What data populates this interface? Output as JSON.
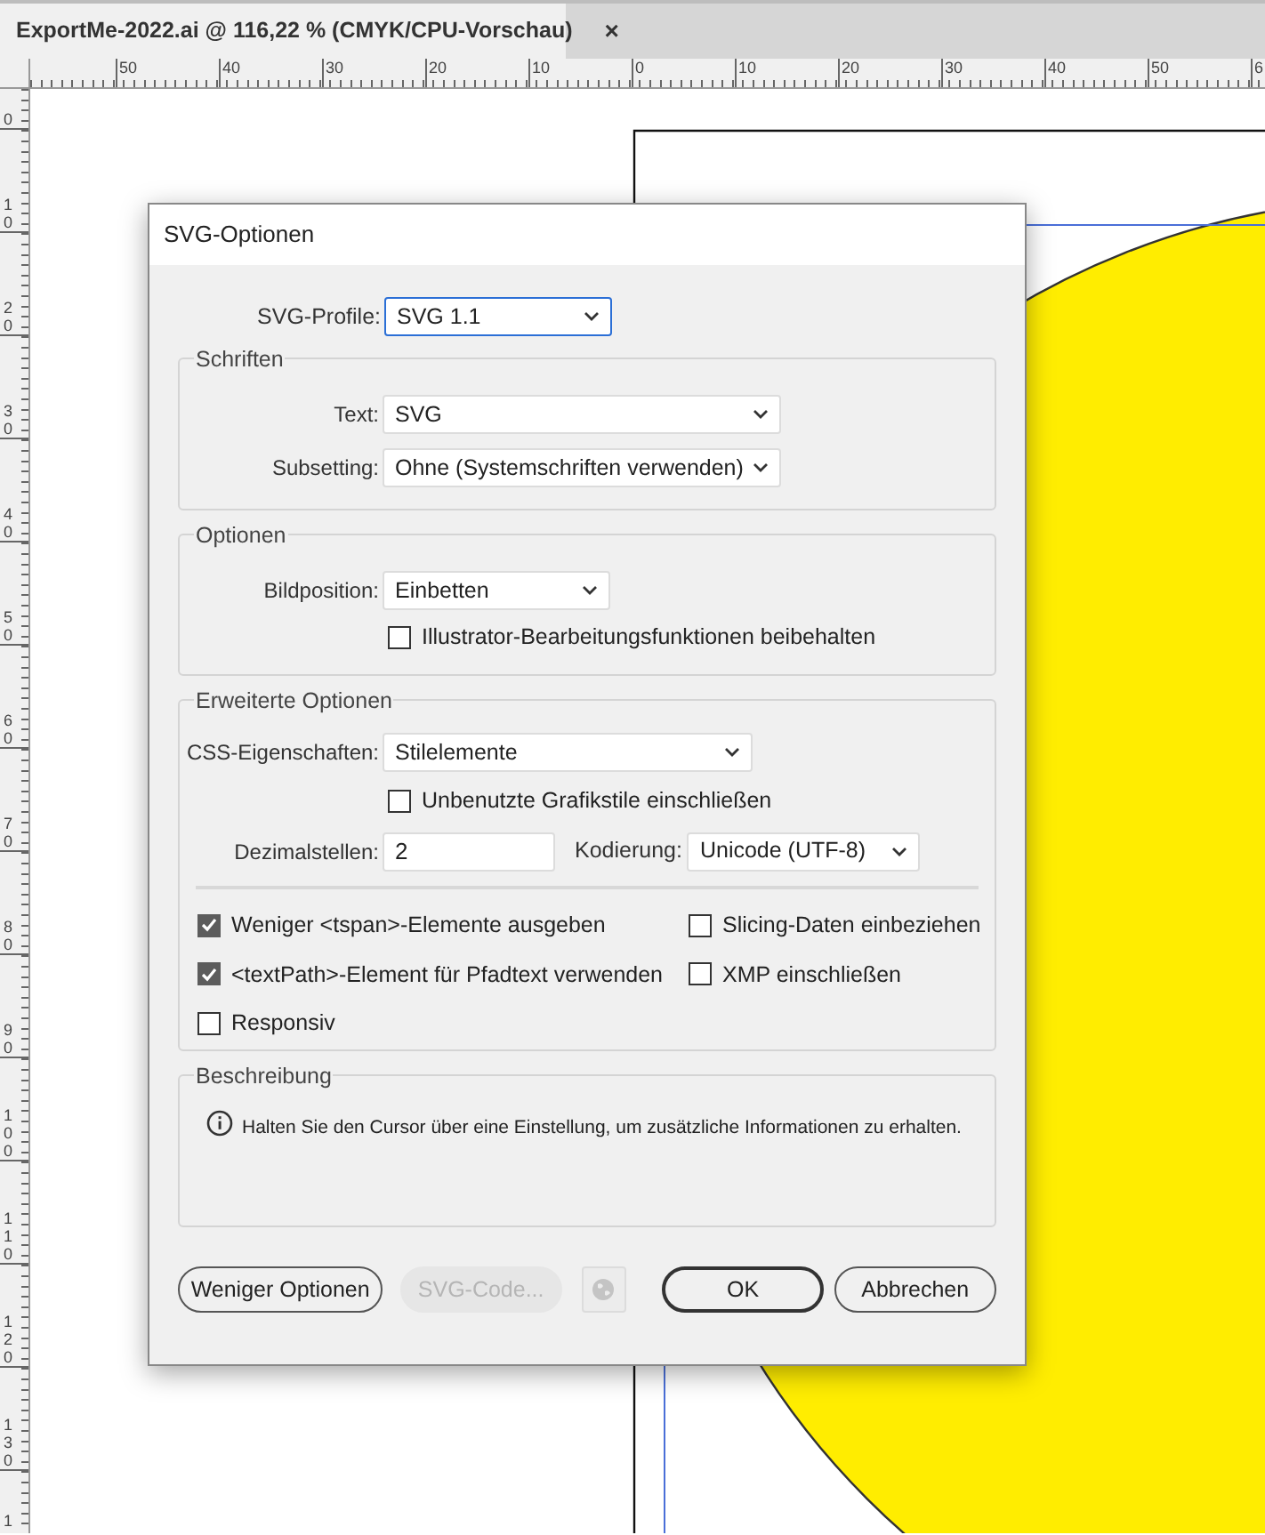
{
  "document_tab": {
    "title": "ExportMe-2022.ai @ 116,22 % (CMYK/CPU-Vorschau)",
    "close": "×",
    "selected": true
  },
  "ruler_top": {
    "labels": [
      "50",
      "40",
      "30",
      "20",
      "10",
      "0",
      "10",
      "20",
      "30",
      "40",
      "50",
      "6"
    ]
  },
  "ruler_left": {
    "labels": [
      "0",
      "10",
      "20",
      "30",
      "40",
      "50",
      "60",
      "70",
      "80",
      "90",
      "100",
      "110",
      "120",
      "130",
      "1"
    ]
  },
  "dialog": {
    "title": "SVG-Optionen",
    "profile": {
      "label": "SVG-Profile:",
      "value": "SVG 1.1"
    },
    "fonts": {
      "legend": "Schriften",
      "rows": [
        {
          "label": "Text:",
          "value": "SVG"
        },
        {
          "label": "Subsetting:",
          "value": "Ohne (Systemschriften verwenden)"
        }
      ]
    },
    "options": {
      "legend": "Optionen",
      "image_position": {
        "label": "Bildposition:",
        "value": "Einbetten"
      },
      "preserve_editing": {
        "label": "Illustrator-Bearbeitungsfunktionen beibehalten",
        "checked": false
      }
    },
    "advanced": {
      "legend": "Erweiterte Optionen",
      "css": {
        "label": "CSS-Eigenschaften:",
        "value": "Stilelemente"
      },
      "unused_styles": {
        "label": "Unbenutzte Grafikstile einschließen",
        "checked": false
      },
      "decimals": {
        "label": "Dezimalstellen:",
        "value": "2"
      },
      "encoding": {
        "label": "Kodierung:",
        "value": "Unicode (UTF-8)"
      },
      "checkboxes": [
        {
          "label": "Weniger <tspan>-Elemente ausgeben",
          "checked": true
        },
        {
          "label": "Slicing-Daten einbeziehen",
          "checked": false
        },
        {
          "label": "<textPath>-Element für Pfadtext verwenden",
          "checked": true
        },
        {
          "label": "XMP einschließen",
          "checked": false
        },
        {
          "label": "Responsiv",
          "checked": false
        }
      ]
    },
    "description": {
      "legend": "Beschreibung",
      "text": "Halten Sie den Cursor über eine Einstellung, um zusätzliche Informationen zu erhalten."
    },
    "buttons": [
      {
        "kind": "text",
        "label": "Weniger Optionen",
        "disabled": false,
        "default": false
      },
      {
        "kind": "text",
        "label": "SVG-Code...",
        "disabled": true,
        "default": false
      },
      {
        "kind": "globe",
        "disabled": true,
        "default": false
      },
      {
        "kind": "text",
        "label": "OK",
        "disabled": false,
        "default": true
      },
      {
        "kind": "text",
        "label": "Abbrechen",
        "disabled": false,
        "default": false
      }
    ]
  }
}
